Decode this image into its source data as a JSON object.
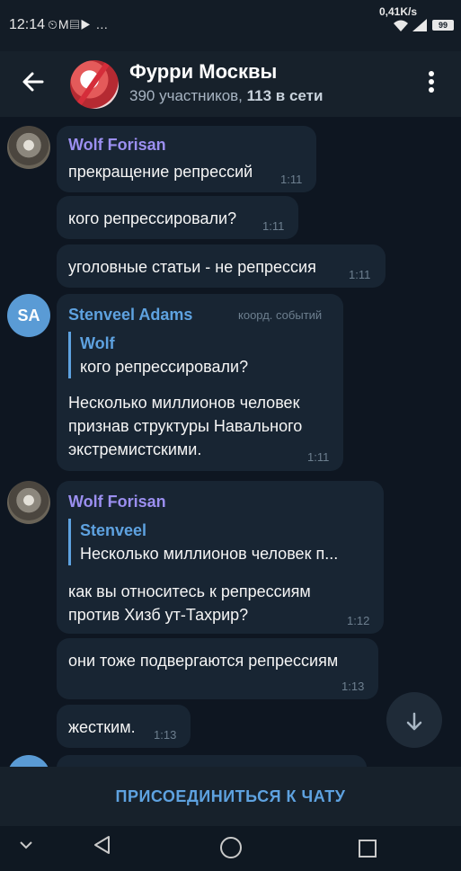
{
  "status_bar": {
    "time": "12:14",
    "icons": "⏲M▤▶ …",
    "net_speed": "0,41K/s",
    "signal": "4G",
    "battery": "99"
  },
  "header": {
    "title": "Фурри Москвы",
    "members": "390 участников,",
    "online": "113 в сети"
  },
  "messages": {
    "m1": {
      "sender": "Wolf Forisan",
      "text": "прекращение репрессий",
      "time": "1:11"
    },
    "m2": {
      "text": "кого репрессировали?",
      "time": "1:11"
    },
    "m3": {
      "text": "уголовные статьи - не репрессия",
      "time": "1:11"
    },
    "m4": {
      "avatar": "SA",
      "sender": "Stenveel Adams",
      "admin_title": "коорд. событий",
      "quote_name": "Wolf",
      "quote_text": "кого репрессировали?",
      "line1": "Несколько миллионов человек",
      "line2": "признав структуры Навального",
      "line3": "экстремистскими.",
      "time": "1:11"
    },
    "m5": {
      "sender": "Wolf Forisan",
      "quote_name": "Stenveel",
      "quote_text": "Несколько миллионов человек п...",
      "line1": "как вы относитесь к репрессиям",
      "line2": "против Хизб ут-Тахрир?",
      "time": "1:12"
    },
    "m6": {
      "text": "они тоже подвергаются репрессиям",
      "time": "1:13"
    },
    "m7": {
      "text": "жестким.",
      "time": "1:13"
    }
  },
  "join_button": "ПРИСОЕДИНИТЬСЯ К ЧАТУ",
  "colors": {
    "background": "#0e1621",
    "bubble": "#182533",
    "header": "#17212b",
    "accent": "#5ea2e0",
    "sender_wolf": "#9b8ff0",
    "sender_stenveel": "#5ea2e0"
  },
  "icons": {
    "back": "arrow-left-icon",
    "menu": "more-vertical-icon",
    "scroll": "chevron-down-icon",
    "nav_hide": "chevron-down-icon",
    "nav_back": "triangle-back-icon",
    "nav_home": "circle-home-icon",
    "nav_recent": "square-recent-icon"
  }
}
